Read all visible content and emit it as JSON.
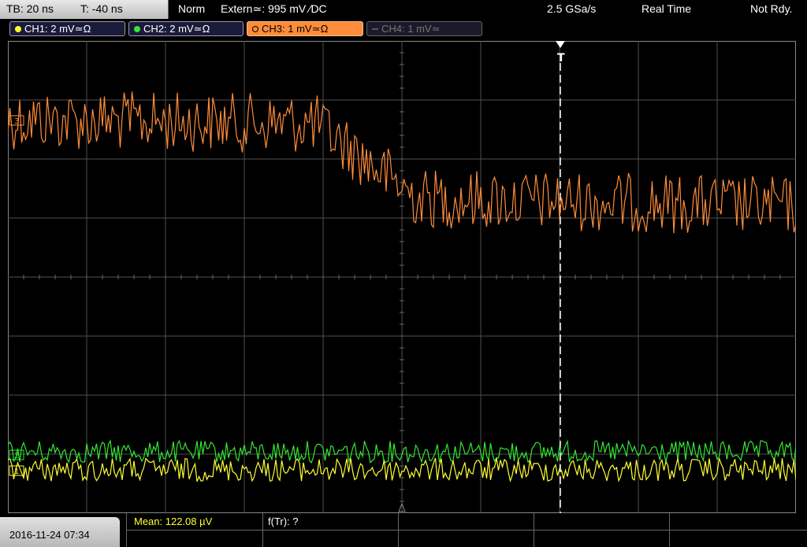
{
  "header": {
    "timebase": "TB: 20 ns",
    "trigger_time": "T: -40 ns",
    "mode": "Norm",
    "trigger_source": "Extern≃: 995 mV ∕DC",
    "sample_rate": "2.5 GSa/s",
    "acq_mode": "Real Time",
    "status": "Not Rdy."
  },
  "channels": [
    {
      "label": "CH1: 2 mV≃Ω",
      "color": "#ffff33",
      "active": true
    },
    {
      "label": "CH2: 2 mV≃Ω",
      "color": "#33e633",
      "active": true
    },
    {
      "label": "CH3: 1 mV≃Ω",
      "color": "#ff8c3a",
      "active": true,
      "selected": true
    },
    {
      "label": "CH4: 1 mV≃",
      "color": "#777777",
      "active": false
    }
  ],
  "markers": {
    "trigger_position_label": "T",
    "ch1_label": "1",
    "ch2_label": "2",
    "ch3_label": "3"
  },
  "footer": {
    "datetime": "2016-11-24 07:34",
    "mean": "Mean: 122.08 µV",
    "f_tr": "f(Tr): ?"
  },
  "colors": {
    "grid": "#505050",
    "trigger_line": "#ffffff"
  }
}
